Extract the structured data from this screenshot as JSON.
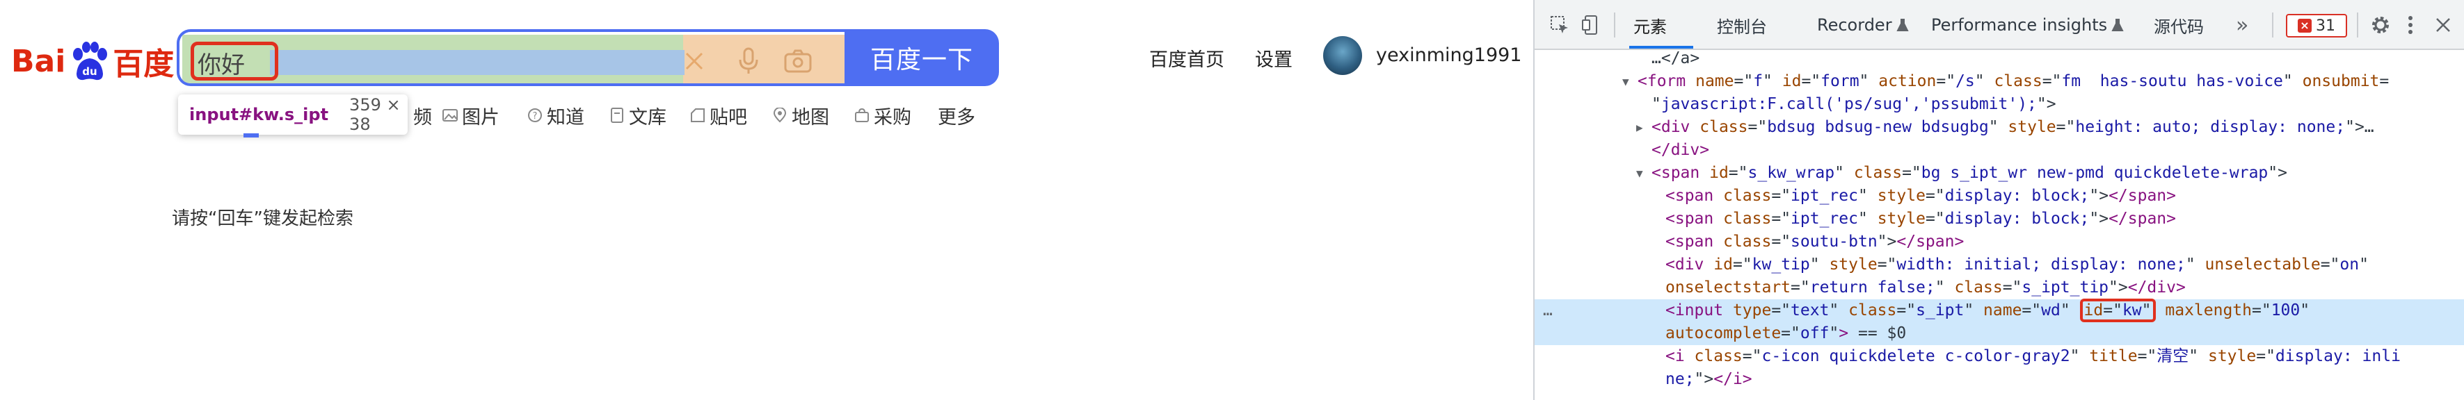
{
  "page": {
    "logo": {
      "text_left": "Bai",
      "text_paw": "du",
      "text_right": "百度"
    },
    "search": {
      "input_value": "你好",
      "button_label": "百度一下"
    },
    "tooltip": {
      "selector": "input#kw.s_ipt",
      "dimensions": "359 × 38"
    },
    "nav": [
      {
        "label": "频",
        "icon": "video-icon"
      },
      {
        "label": "图片",
        "icon": "image-icon"
      },
      {
        "label": "知道",
        "icon": "question-icon"
      },
      {
        "label": "文库",
        "icon": "doc-icon"
      },
      {
        "label": "贴吧",
        "icon": "tieba-icon"
      },
      {
        "label": "地图",
        "icon": "map-icon"
      },
      {
        "label": "采购",
        "icon": "purchase-icon"
      },
      {
        "label": "更多",
        "icon": ""
      }
    ],
    "hint": "请按“回车”键发起检索",
    "top_links": {
      "home": "百度首页",
      "settings": "设置",
      "username": "yexinming1991"
    }
  },
  "devtools": {
    "tabs": [
      "元素",
      "控制台",
      "Recorder",
      "Performance insights",
      "源代码"
    ],
    "active_tab": "元素",
    "issues_count": "31",
    "lines": [
      {
        "indent": 4,
        "tri": "",
        "parts": [
          [
            "pl",
            "…</a>"
          ]
        ]
      },
      {
        "indent": 3,
        "tri": "▼",
        "parts": [
          [
            "tag",
            "<form "
          ],
          [
            "an",
            "name"
          ],
          [
            "pl",
            "=\""
          ],
          [
            "av",
            "f"
          ],
          [
            "pl",
            "\" "
          ],
          [
            "an",
            "id"
          ],
          [
            "pl",
            "=\""
          ],
          [
            "av",
            "form"
          ],
          [
            "pl",
            "\" "
          ],
          [
            "an",
            "action"
          ],
          [
            "pl",
            "=\""
          ],
          [
            "av",
            "/s"
          ],
          [
            "pl",
            "\" "
          ],
          [
            "an",
            "class"
          ],
          [
            "pl",
            "=\""
          ],
          [
            "av",
            "fm  has-soutu has-voice"
          ],
          [
            "pl",
            "\" "
          ],
          [
            "an",
            "onsubmit"
          ],
          [
            "pl",
            "="
          ]
        ]
      },
      {
        "indent": 4,
        "tri": "",
        "parts": [
          [
            "pl",
            "\""
          ],
          [
            "av",
            "javascript:F.call('ps/sug','pssubmit');"
          ],
          [
            "pl",
            "\">"
          ]
        ]
      },
      {
        "indent": 4,
        "tri": "▶",
        "parts": [
          [
            "tag",
            "<div "
          ],
          [
            "an",
            "class"
          ],
          [
            "pl",
            "=\""
          ],
          [
            "av",
            "bdsug bdsug-new bdsugbg"
          ],
          [
            "pl",
            "\" "
          ],
          [
            "an",
            "style"
          ],
          [
            "pl",
            "=\""
          ],
          [
            "av",
            "height: auto; display: none;"
          ],
          [
            "pl",
            "\">…"
          ]
        ]
      },
      {
        "indent": 4,
        "tri": "",
        "parts": [
          [
            "tag",
            "</div>"
          ]
        ]
      },
      {
        "indent": 4,
        "tri": "▼",
        "parts": [
          [
            "tag",
            "<span "
          ],
          [
            "an",
            "id"
          ],
          [
            "pl",
            "=\""
          ],
          [
            "av",
            "s_kw_wrap"
          ],
          [
            "pl",
            "\" "
          ],
          [
            "an",
            "class"
          ],
          [
            "pl",
            "=\""
          ],
          [
            "av",
            "bg s_ipt_wr new-pmd quickdelete-wrap"
          ],
          [
            "pl",
            "\">"
          ]
        ]
      },
      {
        "indent": 5,
        "tri": "",
        "parts": [
          [
            "tag",
            "<span "
          ],
          [
            "an",
            "class"
          ],
          [
            "pl",
            "=\""
          ],
          [
            "av",
            "ipt_rec"
          ],
          [
            "pl",
            "\" "
          ],
          [
            "an",
            "style"
          ],
          [
            "pl",
            "=\""
          ],
          [
            "av",
            "display: block;"
          ],
          [
            "pl",
            "\">"
          ],
          [
            "tag",
            "</span>"
          ]
        ]
      },
      {
        "indent": 5,
        "tri": "",
        "parts": [
          [
            "tag",
            "<span "
          ],
          [
            "an",
            "class"
          ],
          [
            "pl",
            "=\""
          ],
          [
            "av",
            "ipt_rec"
          ],
          [
            "pl",
            "\" "
          ],
          [
            "an",
            "style"
          ],
          [
            "pl",
            "=\""
          ],
          [
            "av",
            "display: block;"
          ],
          [
            "pl",
            "\">"
          ],
          [
            "tag",
            "</span>"
          ]
        ]
      },
      {
        "indent": 5,
        "tri": "",
        "parts": [
          [
            "tag",
            "<span "
          ],
          [
            "an",
            "class"
          ],
          [
            "pl",
            "=\""
          ],
          [
            "av",
            "soutu-btn"
          ],
          [
            "pl",
            "\">"
          ],
          [
            "tag",
            "</span>"
          ]
        ]
      },
      {
        "indent": 5,
        "tri": "",
        "parts": [
          [
            "tag",
            "<div "
          ],
          [
            "an",
            "id"
          ],
          [
            "pl",
            "=\""
          ],
          [
            "av",
            "kw_tip"
          ],
          [
            "pl",
            "\" "
          ],
          [
            "an",
            "style"
          ],
          [
            "pl",
            "=\""
          ],
          [
            "av",
            "width: initial; display: none;"
          ],
          [
            "pl",
            "\" "
          ],
          [
            "an",
            "unselectable"
          ],
          [
            "pl",
            "=\""
          ],
          [
            "av",
            "on"
          ],
          [
            "pl",
            "\""
          ]
        ]
      },
      {
        "indent": 5,
        "tri": "",
        "parts": [
          [
            "an",
            "onselectstart"
          ],
          [
            "pl",
            "=\""
          ],
          [
            "av",
            "return false;"
          ],
          [
            "pl",
            "\" "
          ],
          [
            "an",
            "class"
          ],
          [
            "pl",
            "=\""
          ],
          [
            "av",
            "s_ipt_tip"
          ],
          [
            "pl",
            "\">"
          ],
          [
            "tag",
            "</div>"
          ]
        ]
      },
      {
        "indent": 5,
        "tri": "",
        "selected": true,
        "gutter": "…",
        "parts": [
          [
            "tag",
            "<input "
          ],
          [
            "an",
            "type"
          ],
          [
            "pl",
            "=\""
          ],
          [
            "av",
            "text"
          ],
          [
            "pl",
            "\" "
          ],
          [
            "an",
            "class"
          ],
          [
            "pl",
            "=\""
          ],
          [
            "av",
            "s_ipt"
          ],
          [
            "pl",
            "\" "
          ],
          [
            "an",
            "name"
          ],
          [
            "pl",
            "=\""
          ],
          [
            "av",
            "wd"
          ],
          [
            "pl",
            "\" "
          ],
          [
            "box",
            "id=\"kw\""
          ],
          [
            "pl",
            " "
          ],
          [
            "an",
            "maxlength"
          ],
          [
            "pl",
            "=\""
          ],
          [
            "av",
            "100"
          ],
          [
            "pl",
            "\""
          ]
        ]
      },
      {
        "indent": 5,
        "tri": "",
        "selected": true,
        "parts": [
          [
            "an",
            "autocomplete"
          ],
          [
            "pl",
            "=\""
          ],
          [
            "av",
            "off"
          ],
          [
            "pl",
            "\""
          ],
          [
            "tag",
            ">"
          ],
          [
            "pl",
            " == $0"
          ]
        ]
      },
      {
        "indent": 5,
        "tri": "",
        "parts": [
          [
            "tag",
            "<i "
          ],
          [
            "an",
            "class"
          ],
          [
            "pl",
            "=\""
          ],
          [
            "av",
            "c-icon quickdelete c-color-gray2"
          ],
          [
            "pl",
            "\" "
          ],
          [
            "an",
            "title"
          ],
          [
            "pl",
            "=\""
          ],
          [
            "av",
            "清空"
          ],
          [
            "pl",
            "\" "
          ],
          [
            "an",
            "style"
          ],
          [
            "pl",
            "=\""
          ],
          [
            "av",
            "display: inli"
          ]
        ]
      },
      {
        "indent": 5,
        "tri": "",
        "parts": [
          [
            "av",
            "ne;"
          ],
          [
            "pl",
            "\">"
          ],
          [
            "pl",
            ""
          ],
          [
            "tag",
            "</i>"
          ]
        ]
      }
    ]
  },
  "colors": {
    "brand_blue": "#4e6ef2",
    "baidu_red": "#de2910",
    "highlight_red": "#e0301e",
    "selected_row": "#cfe8fc"
  }
}
